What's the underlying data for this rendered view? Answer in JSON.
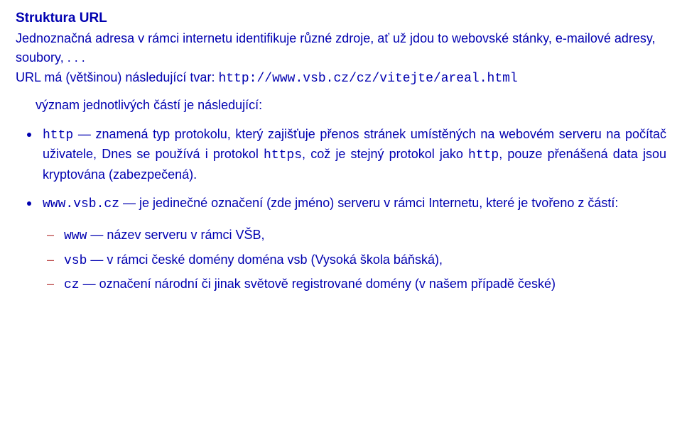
{
  "title": "Struktura URL",
  "intro_line1": "Jednoznačná adresa v rámci internetu identifikuje různé zdroje, ať už jdou to webovské stánky, e-mailové adresy, soubory, . . .",
  "intro_line2_a": "URL má (většinou) následující tvar: ",
  "intro_line2_code": "http://www.vsb.cz/cz/vitejte/areal.html",
  "meaning": "význam jednotlivých částí je následující:",
  "bullets": [
    {
      "code": "http",
      "text1": " — znamená typ protokolu, který zajišťuje přenos stránek umístěných na webovém serveru na počítač uživatele, Dnes se používá i protokol ",
      "code2": "https",
      "text2": ", což je stejný protokol jako ",
      "code3": "http",
      "text3": ", pouze přenášená data jsou kryptována (zabezpečená)."
    },
    {
      "code": "www.vsb.cz",
      "text1": " — je jedinečné označení (zde jméno) serveru v rámci Internetu, které je tvořeno z částí:",
      "sub": [
        {
          "code": "www",
          "text": " — název serveru v rámci VŠB,"
        },
        {
          "code": "vsb",
          "text": " — v rámci české domény doména vsb (Vysoká škola báňská),"
        },
        {
          "code": "cz",
          "text": " — označení národní či jinak světově registrované domény (v našem případě české)"
        }
      ]
    }
  ]
}
